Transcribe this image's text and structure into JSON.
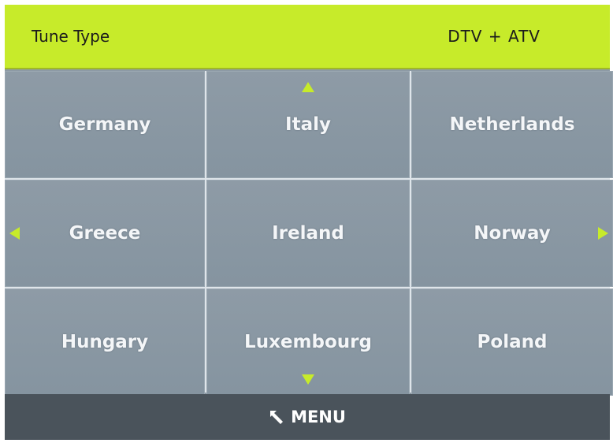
{
  "header": {
    "label": "Tune Type",
    "value": "DTV + ATV"
  },
  "countries": [
    "Germany",
    "Italy",
    "Netherlands",
    "Greece",
    "Ireland",
    "Norway",
    "Hungary",
    "Luxembourg",
    "Poland"
  ],
  "footer": {
    "menu_label": "MENU",
    "menu_icon": "return-arrow-icon"
  },
  "colors": {
    "accent": "#c7eb2a",
    "cell": "#8d9aa5",
    "footer": "#4a535b",
    "text": "#f4f6f8"
  },
  "nav_icons": [
    "arrow-up-icon",
    "arrow-down-icon",
    "arrow-left-icon",
    "arrow-right-icon"
  ]
}
